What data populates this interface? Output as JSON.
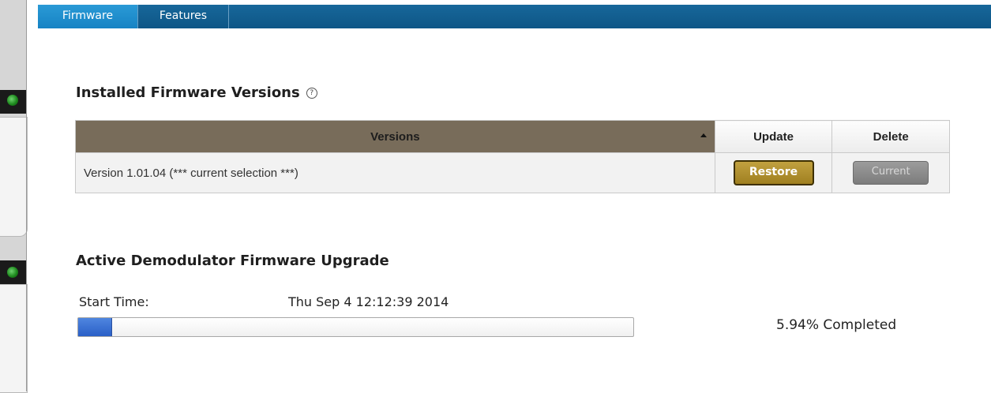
{
  "tabs": [
    {
      "label": "Firmware",
      "active": true
    },
    {
      "label": "Features",
      "active": false
    }
  ],
  "installed": {
    "title": "Installed Firmware Versions",
    "help_icon": "help-circle-icon",
    "columns": {
      "versions": "Versions",
      "update": "Update",
      "delete": "Delete"
    },
    "rows": [
      {
        "version": "Version 1.01.04 (*** current selection ***)",
        "update_label": "Restore",
        "delete_label": "Current"
      }
    ]
  },
  "upgrade": {
    "title": "Active Demodulator Firmware Upgrade",
    "start_label": "Start Time:",
    "start_value": "Thu Sep 4 12:12:39 2014",
    "progress_percent": 5.94,
    "completed_text": "5.94% Completed"
  },
  "colors": {
    "tabbar": "#0e5686",
    "active_tab": "#1683c4",
    "versions_header": "#786c5a",
    "restore_button": "#a88a2a",
    "progress_fill": "#3a6fd8",
    "status_led": "#1e8a1e"
  }
}
